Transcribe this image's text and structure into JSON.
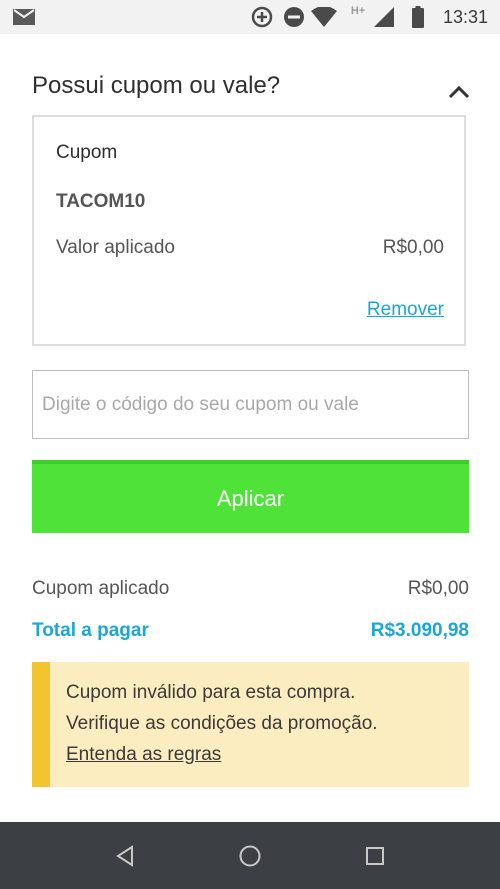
{
  "status_bar": {
    "time": "13:31",
    "network_label": "H+",
    "icons": [
      "mail-icon",
      "data-saver-icon",
      "do-not-disturb-icon",
      "wifi-icon",
      "signal-icon",
      "battery-icon"
    ]
  },
  "coupon_section": {
    "title": "Possui cupom ou vale?",
    "toggle_icon": "chevron-up-icon",
    "applied_coupon": {
      "label": "Cupom",
      "code": "TACOM10",
      "applied_label": "Valor aplicado",
      "applied_value": "R$0,00",
      "remove_label": "Remover"
    },
    "input": {
      "value": "",
      "placeholder": "Digite o código do seu cupom ou vale"
    },
    "apply_button_label": "Aplicar"
  },
  "summary": {
    "coupon_applied_label": "Cupom aplicado",
    "coupon_applied_value": "R$0,00",
    "total_label": "Total a pagar",
    "total_value": "R$3.090,98"
  },
  "warning": {
    "line1": "Cupom inválido para esta compra.",
    "line2": "Verifique as condições da promoção.",
    "link": "Entenda as regras"
  },
  "nav_bar": {
    "icons": [
      "back-icon",
      "home-icon",
      "recents-icon"
    ]
  },
  "colors": {
    "accent_blue": "#1aa7d6",
    "apply_green": "#4fe33a",
    "warning_bg": "#fbedc0",
    "warning_stripe": "#f2c530",
    "nav_bar_bg": "#3c3f44"
  }
}
